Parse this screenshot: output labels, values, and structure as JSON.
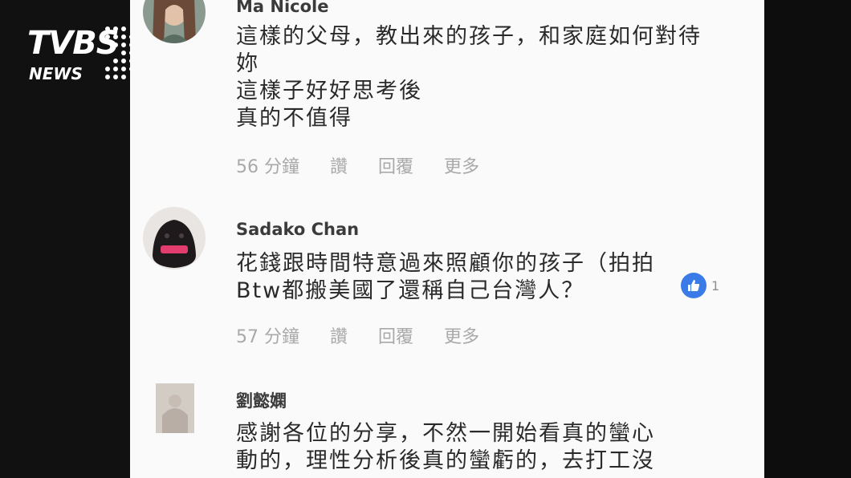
{
  "logo": {
    "brand": "TVBS",
    "sub": "NEWS"
  },
  "comments": [
    {
      "author": "Ma Nicole",
      "text": "這樣的父母，教出來的孩子，和家庭如何對待\n妳\n這樣子好好思考後\n真的不值得",
      "time": "56 分鐘",
      "like": "讚",
      "reply": "回覆",
      "more": "更多"
    },
    {
      "author": "Sadako Chan",
      "text": "花錢跟時間特意過來照顧你的孩子（拍拍\nBtw都搬美國了還稱自己台灣人？",
      "reaction_count": "1",
      "time": "57 分鐘",
      "like": "讚",
      "reply": "回覆",
      "more": "更多"
    },
    {
      "author": "劉懿嫻",
      "text": "感謝各位的分享，不然一開始看真的蠻心\n動的，理性分析後真的蠻虧的，去打工沒"
    }
  ]
}
